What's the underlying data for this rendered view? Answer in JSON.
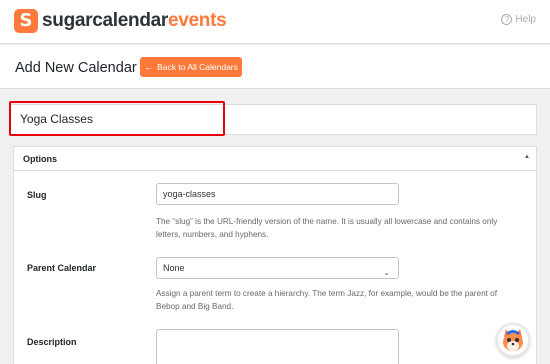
{
  "brand": {
    "mark": "S",
    "name_part1": "sugarcalendar",
    "name_part2": "events",
    "accent": "#ff7a3a"
  },
  "header": {
    "help_label": "Help",
    "help_icon": "question-circle-icon"
  },
  "page": {
    "title": "Add New Calendar",
    "back_button": "Back to All Calendars",
    "back_icon": "arrow-left-icon"
  },
  "name_field": {
    "value": "Yoga Classes"
  },
  "options": {
    "title": "Options",
    "slug": {
      "label": "Slug",
      "value": "yoga-classes",
      "hint_line1": "The “slug” is the URL-friendly version of the name. It is usually all lowercase and contains only",
      "hint_line2": "letters, numbers, and hyphens."
    },
    "parent": {
      "label": "Parent Calendar",
      "selected": "None",
      "hint_line1": "Assign a parent term to create a hierarchy. The term Jazz, for example, would be the parent of",
      "hint_line2": "Bebop and Big Band."
    },
    "description": {
      "label": "Description",
      "value": ""
    }
  },
  "colors": {
    "highlight": "#e8000b",
    "accent": "#ff7a3a"
  }
}
